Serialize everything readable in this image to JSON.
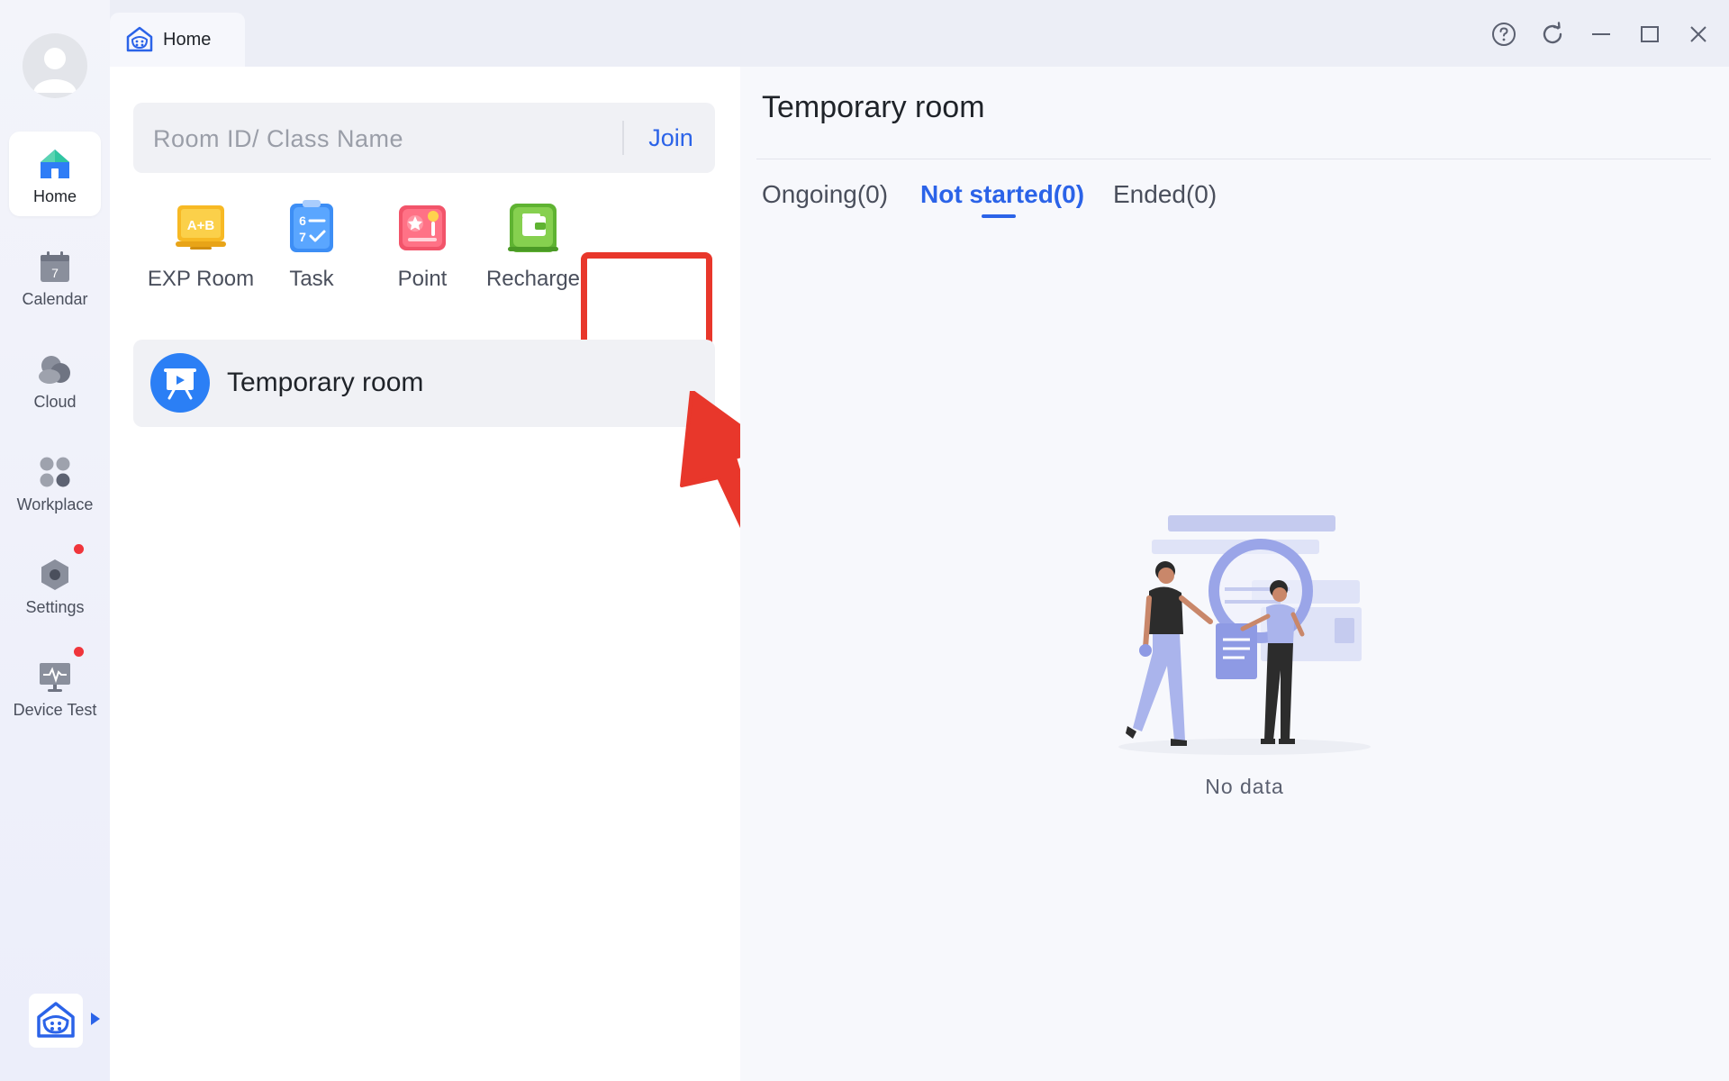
{
  "window": {
    "tab_label": "Home",
    "controls": [
      "help-icon",
      "refresh-icon",
      "minimize-icon",
      "maximize-icon",
      "close-icon"
    ]
  },
  "sidebar": {
    "items": [
      {
        "label": "Home",
        "icon": "home-icon",
        "active": true
      },
      {
        "label": "Calendar",
        "icon": "calendar-icon",
        "calendar_day": "7"
      },
      {
        "label": "Cloud",
        "icon": "cloud-icon"
      },
      {
        "label": "Workplace",
        "icon": "grid-icon"
      },
      {
        "label": "Settings",
        "icon": "settings-icon",
        "badge": true
      },
      {
        "label": "Device Test",
        "icon": "device-test-icon",
        "badge": true
      }
    ]
  },
  "search": {
    "placeholder": "Room ID/ Class Name",
    "join_label": "Join"
  },
  "quick_actions": [
    {
      "label": "EXP Room",
      "icon": "exp-room-icon",
      "icon_text": "A+B"
    },
    {
      "label": "Task",
      "icon": "task-icon",
      "icon_text": "6 7"
    },
    {
      "label": "Point",
      "icon": "point-icon"
    },
    {
      "label": "Recharge",
      "icon": "recharge-icon",
      "highlighted": true
    }
  ],
  "temporary_room_card": {
    "label": "Temporary room",
    "icon": "presentation-icon"
  },
  "right_panel": {
    "title": "Temporary room",
    "tabs": [
      {
        "label": "Ongoing(0)",
        "active": false
      },
      {
        "label": "Not started(0)",
        "active": true
      },
      {
        "label": "Ended(0)",
        "active": false
      }
    ],
    "empty_text": "No data"
  },
  "colors": {
    "accent": "#2b63e8",
    "highlight": "#e8372b",
    "badge": "#f0353b"
  }
}
